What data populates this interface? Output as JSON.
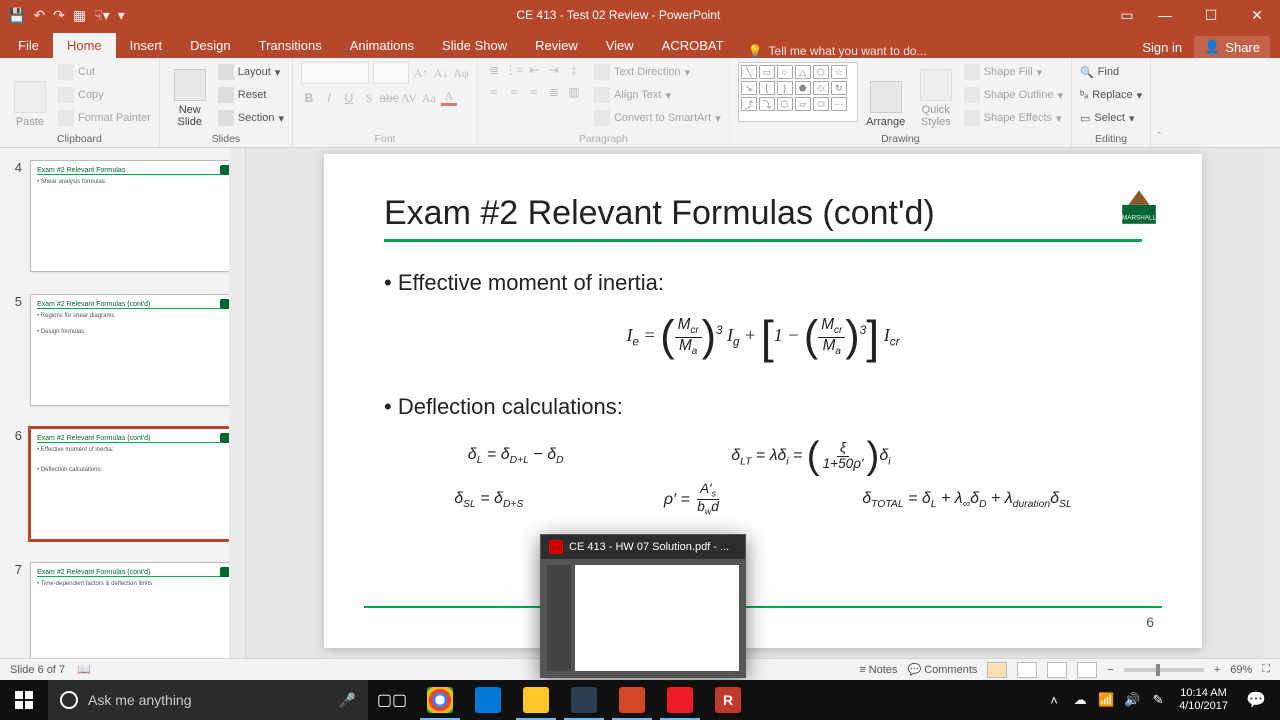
{
  "app": {
    "title": "CE 413 - Test 02 Review - PowerPoint",
    "signin": "Sign in",
    "share": "Share"
  },
  "tabs": {
    "file": "File",
    "home": "Home",
    "insert": "Insert",
    "design": "Design",
    "transitions": "Transitions",
    "animations": "Animations",
    "slideshow": "Slide Show",
    "review": "Review",
    "view": "View",
    "acrobat": "ACROBAT",
    "tellme": "Tell me what you want to do..."
  },
  "ribbon": {
    "paste": "Paste",
    "cut": "Cut",
    "copy": "Copy",
    "formatpainter": "Format Painter",
    "clipboard": "Clipboard",
    "newslide": "New\nSlide",
    "layout": "Layout",
    "reset": "Reset",
    "section": "Section",
    "slides": "Slides",
    "font": "Font",
    "paragraph": "Paragraph",
    "textdir": "Text Direction",
    "aligntext": "Align Text",
    "smartart": "Convert to SmartArt",
    "arrange": "Arrange",
    "quickstyles": "Quick\nStyles",
    "shapefill": "Shape Fill",
    "shapeoutline": "Shape Outline",
    "shapeeffects": "Shape Effects",
    "drawing": "Drawing",
    "find": "Find",
    "replace": "Replace",
    "select": "Select",
    "editing": "Editing"
  },
  "thumbs": [
    {
      "num": "4",
      "title": "Exam #2 Relevant Formulas"
    },
    {
      "num": "5",
      "title": "Exam #2 Relevant Formulas (cont'd)"
    },
    {
      "num": "6",
      "title": "Exam #2 Relevant Formulas (cont'd)"
    },
    {
      "num": "7",
      "title": "Exam #2 Relevant Formulas (cont'd)"
    }
  ],
  "slide": {
    "title": "Exam #2 Relevant Formulas (cont'd)",
    "b1": "Effective moment of inertia:",
    "b2": "Deflection calculations:",
    "pagenum": "6"
  },
  "status": {
    "slideinfo": "Slide 6 of 7",
    "notes": "Notes",
    "comments": "Comments",
    "zoom": "69%"
  },
  "taskbar": {
    "search": "Ask me anything",
    "preview_title": "CE 413 - HW 07 Solution.pdf - ...",
    "time": "10:14 AM",
    "date": "4/10/2017"
  }
}
